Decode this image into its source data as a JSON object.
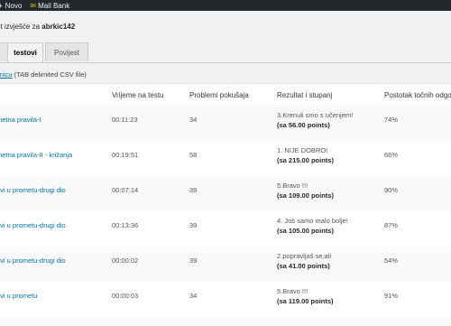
{
  "adminbar": {
    "plus": "+",
    "new_label": "Novo",
    "mail_label": "Mail Bank"
  },
  "subtitle": {
    "prefix": "est izvješće za",
    "user": "abrkic142"
  },
  "tabs": [
    {
      "label": "",
      "active": false
    },
    {
      "label": "testovi",
      "active": true
    },
    {
      "label": "Povijest",
      "active": false
    }
  ],
  "csv": {
    "link_text": "tranicu",
    "note": "(TAB delimited CSV file)"
  },
  "table": {
    "headers": {
      "name": "",
      "time": "Vrijeme na testu",
      "problems": "Problemi pokušaja",
      "result": "Rezultat i stupanj",
      "percent": "Postotak točnih odgo"
    },
    "rows": [
      {
        "name": "metna pravila-I",
        "time": "00:11:23",
        "problems": "34",
        "result": "3.Krenuli smo s učenjem!",
        "points": "(sa 56.00 points)",
        "percent": "74%"
      },
      {
        "name": "metna pravila-II - križanja",
        "time": "00:19:51",
        "problems": "58",
        "result": "1. NIJE DOBRO!",
        "points": "(sa 215.00 points)",
        "percent": "66%"
      },
      {
        "name": "ovi u prometu-drugi dio",
        "time": "00:07:14",
        "problems": "39",
        "result": "5.Bravo !!!",
        "points": "(sa 109.00 points)",
        "percent": "90%"
      },
      {
        "name": "ovi u prometu-drugi dio",
        "time": "00:13:36",
        "problems": "39",
        "result": "4. Još samo malo bolje!",
        "points": "(sa 105.00 points)",
        "percent": "87%"
      },
      {
        "name": "ovi u prometu-drugi dio",
        "time": "00:00:02",
        "problems": "39",
        "result": "2.popravljaš se,ali",
        "points": "(sa 41.00 points)",
        "percent": "54%"
      },
      {
        "name": "ovi u prometu",
        "time": "00:00:03",
        "problems": "34",
        "result": "5.Bravo !!!",
        "points": "(sa 119.00 points)",
        "percent": "91%"
      }
    ]
  }
}
